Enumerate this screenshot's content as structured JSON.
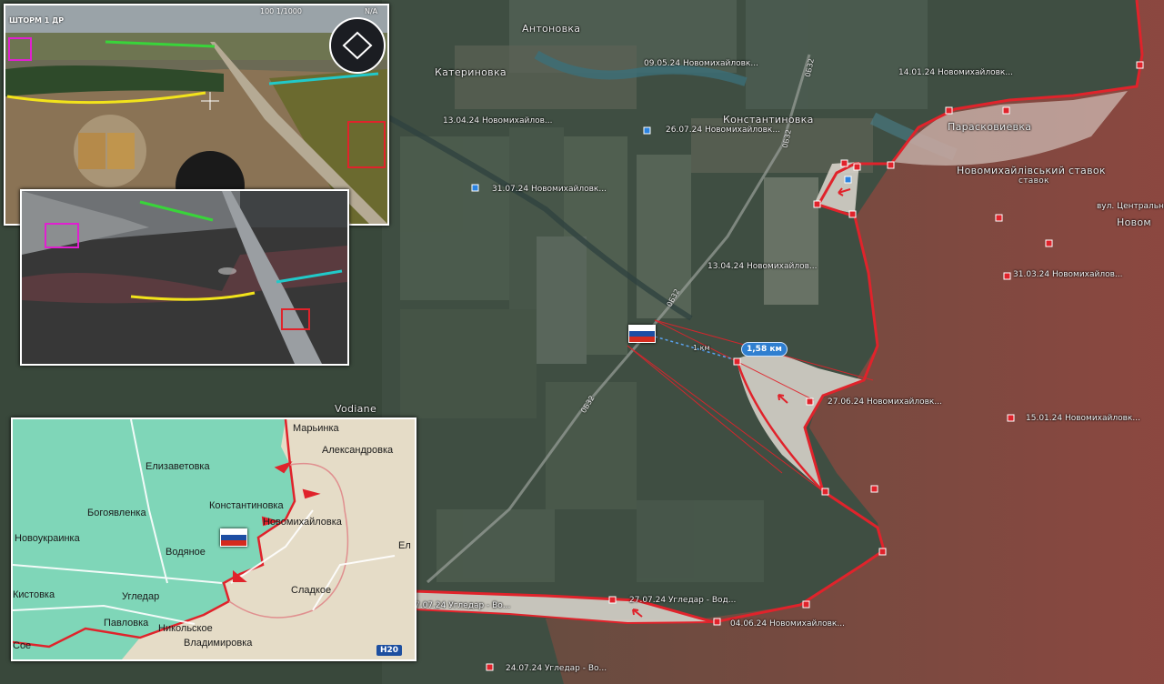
{
  "places": {
    "antonovka": "Антоновка",
    "katerinovka": "Катериновка",
    "konstantinovka": "Константиновка",
    "paraskovievka": "Парасковиевка",
    "reservoir": "Новомихайлівський ставок",
    "vodiane": "Vodiane",
    "novomikh_right": "Новом",
    "street": "вул. Центральна"
  },
  "roads": [
    "0Б32",
    "0Б32",
    "0Б32",
    "0Б32"
  ],
  "dated_labels": [
    "09.05.24 Новомихайловк...",
    "14.01.24 Новомихайловк...",
    "13.04.24 Новомихайлов...",
    "26.07.24 Новомихайловк...",
    "31.07.24 Новомихайловк...",
    "13.04.24 Новомихайлов...",
    "31.03.24 Новомихайлов...",
    "27.06.24 Новомихайловк...",
    "15.01.24 Новомихайловк...",
    "27.07.24 Угледар - Вод...",
    "7.07.24 Угледар - Во...",
    "04.06.24 Новомихайловк...",
    "24.07.24 Угледар - Во..."
  ],
  "distance": {
    "main": "1,58 км",
    "small": "1 км"
  },
  "drone": {
    "channel": "ШТОРМ 1 ДР",
    "readout1": "100 1/1000",
    "readout2": "N/A"
  },
  "inset_map": {
    "places": [
      "Марьинка",
      "Александровка",
      "Елизаветовка",
      "Константиновка",
      "Богоявленка",
      "Новомихайловка",
      "Новоукраинка",
      "Водяное",
      "Ел",
      "Угледар",
      "Сладкое",
      "Кистовка",
      "Павловка",
      "Никольское",
      "Владимировка",
      "Сое"
    ],
    "road_badge": "H20"
  },
  "colors": {
    "front_line": "#e0232b",
    "russian_zone": "#b8504f",
    "contested": "#e8e2da",
    "map_green": "#7fd6b8",
    "flag_white": "#ffffff",
    "flag_blue": "#1d4ea3",
    "flag_red": "#d52b1e"
  }
}
